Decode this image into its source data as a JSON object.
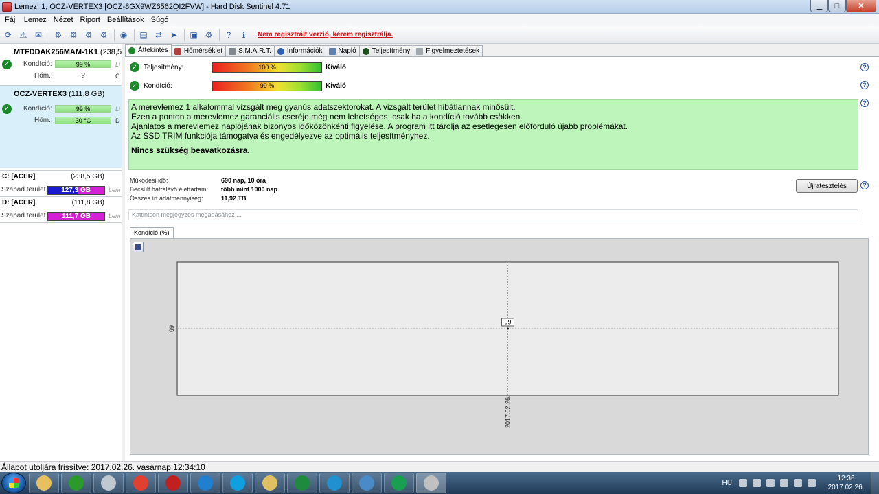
{
  "window": {
    "title": "Lemez: 1, OCZ-VERTEX3 [OCZ-8GX9WZ6562QI2FVW]  -  Hard Disk Sentinel 4.71",
    "minimize": "▁",
    "maximize": "□",
    "close": "✕"
  },
  "menu": [
    "Fájl",
    "Lemez",
    "Nézet",
    "Riport",
    "Beállítások",
    "Súgó"
  ],
  "toolbar": {
    "register_text": "Nem regisztrált verzió, kérem regisztrálja."
  },
  "disks": [
    {
      "name": "MTFDDAK256MAM-1K1",
      "size": "(238,5 G",
      "condition_label": "Kondíció:",
      "condition": "99 %",
      "condition_cut": "Li",
      "temp_label": "Hőm.:",
      "temp": "?",
      "temp_cut": "C"
    },
    {
      "name": "OCZ-VERTEX3",
      "size": "(111,8 GB)",
      "condition_label": "Kondíció:",
      "condition": "99 %",
      "condition_cut": "Li",
      "temp_label": "Hőm.:",
      "temp": "30 °C",
      "temp_cut": "D"
    }
  ],
  "volumes": [
    {
      "name": "C: [ACER]",
      "size": "(238,5 GB)",
      "free_label": "Szabad terület",
      "free": "127,3 GB",
      "free_fraction": 0.53,
      "cut": "Lem"
    },
    {
      "name": "D: [ACER]",
      "size": "(111,8 GB)",
      "free_label": "Szabad terület",
      "free": "111,7 GB",
      "free_fraction": 0.0,
      "cut": "Lem"
    }
  ],
  "tabs": [
    "Áttekintés",
    "Hőmérséklet",
    "S.M.A.R.T.",
    "Információk",
    "Napló",
    "Teljesítmény",
    "Figyelmeztetések"
  ],
  "overview": {
    "performance_label": "Teljesítmény:",
    "performance_value": "100 %",
    "performance_verdict": "Kiváló",
    "condition_label": "Kondíció:",
    "condition_value": "99 %",
    "condition_verdict": "Kiváló",
    "help": "?",
    "summary_lines": [
      "A merevlemez 1 alkalommal vizsgált meg gyanús adatszektorokat. A vizsgált terület hibátlannak minősült.",
      "Ezen a ponton a merevlemez garanciális cseréje még nem lehetséges, csak ha a kondíció tovább csökken.",
      "Ajánlatos a merevlemez naplójának bizonyos időközönkénti figyelése. A program itt tárolja az esetlegesen előforduló újabb problémákat.",
      "Az SSD TRIM funkciója támogatva és engedélyezve az optimális teljesítményhez."
    ],
    "summary_strong": "Nincs szükség beavatkozásra.",
    "uptime_label": "Működési idő:",
    "uptime_value": "690 nap, 10 óra",
    "lifetime_label": "Becsült hátralévő élettartam:",
    "lifetime_value": "több mint 1000 nap",
    "written_label": "Összes írt adatmennyiség:",
    "written_value": "11,92 TB",
    "retest_label": "Újratesztelés",
    "note_placeholder": "Kattintson megjegyzés megadásához ..."
  },
  "chart_tab": "Kondíció  (%)",
  "chart_data": {
    "type": "line",
    "x": [
      "2017.02.26."
    ],
    "series": [
      {
        "values": [
          99
        ]
      }
    ],
    "ytick_labels": [
      "99"
    ],
    "data_labels": [
      "99"
    ],
    "grid": true
  },
  "status": "Állapot utoljára frissítve: 2017.02.26. vasárnap 12:34:10",
  "taskbar": {
    "lang": "HU",
    "time": "12:36",
    "date": "2017.02.26.",
    "apps": [
      "file-explorer-icon",
      "utorrent-icon",
      "calculator-icon",
      "chrome-icon",
      "unknown-app-icon",
      "ccleaner-icon",
      "skype-icon",
      "folder-icon",
      "excel-icon",
      "kodi-icon",
      "control-panel-icon",
      "hangouts-icon",
      "hard-disk-sentinel-icon"
    ],
    "app_colors": [
      "#e8c060",
      "#2a9a2a",
      "#c0c8d0",
      "#e04030",
      "#c02020",
      "#2080d0",
      "#10a0e0",
      "#e0c060",
      "#1e8a3e",
      "#2090d0",
      "#4a8ac8",
      "#18a050",
      "#c0c0c0"
    ]
  }
}
